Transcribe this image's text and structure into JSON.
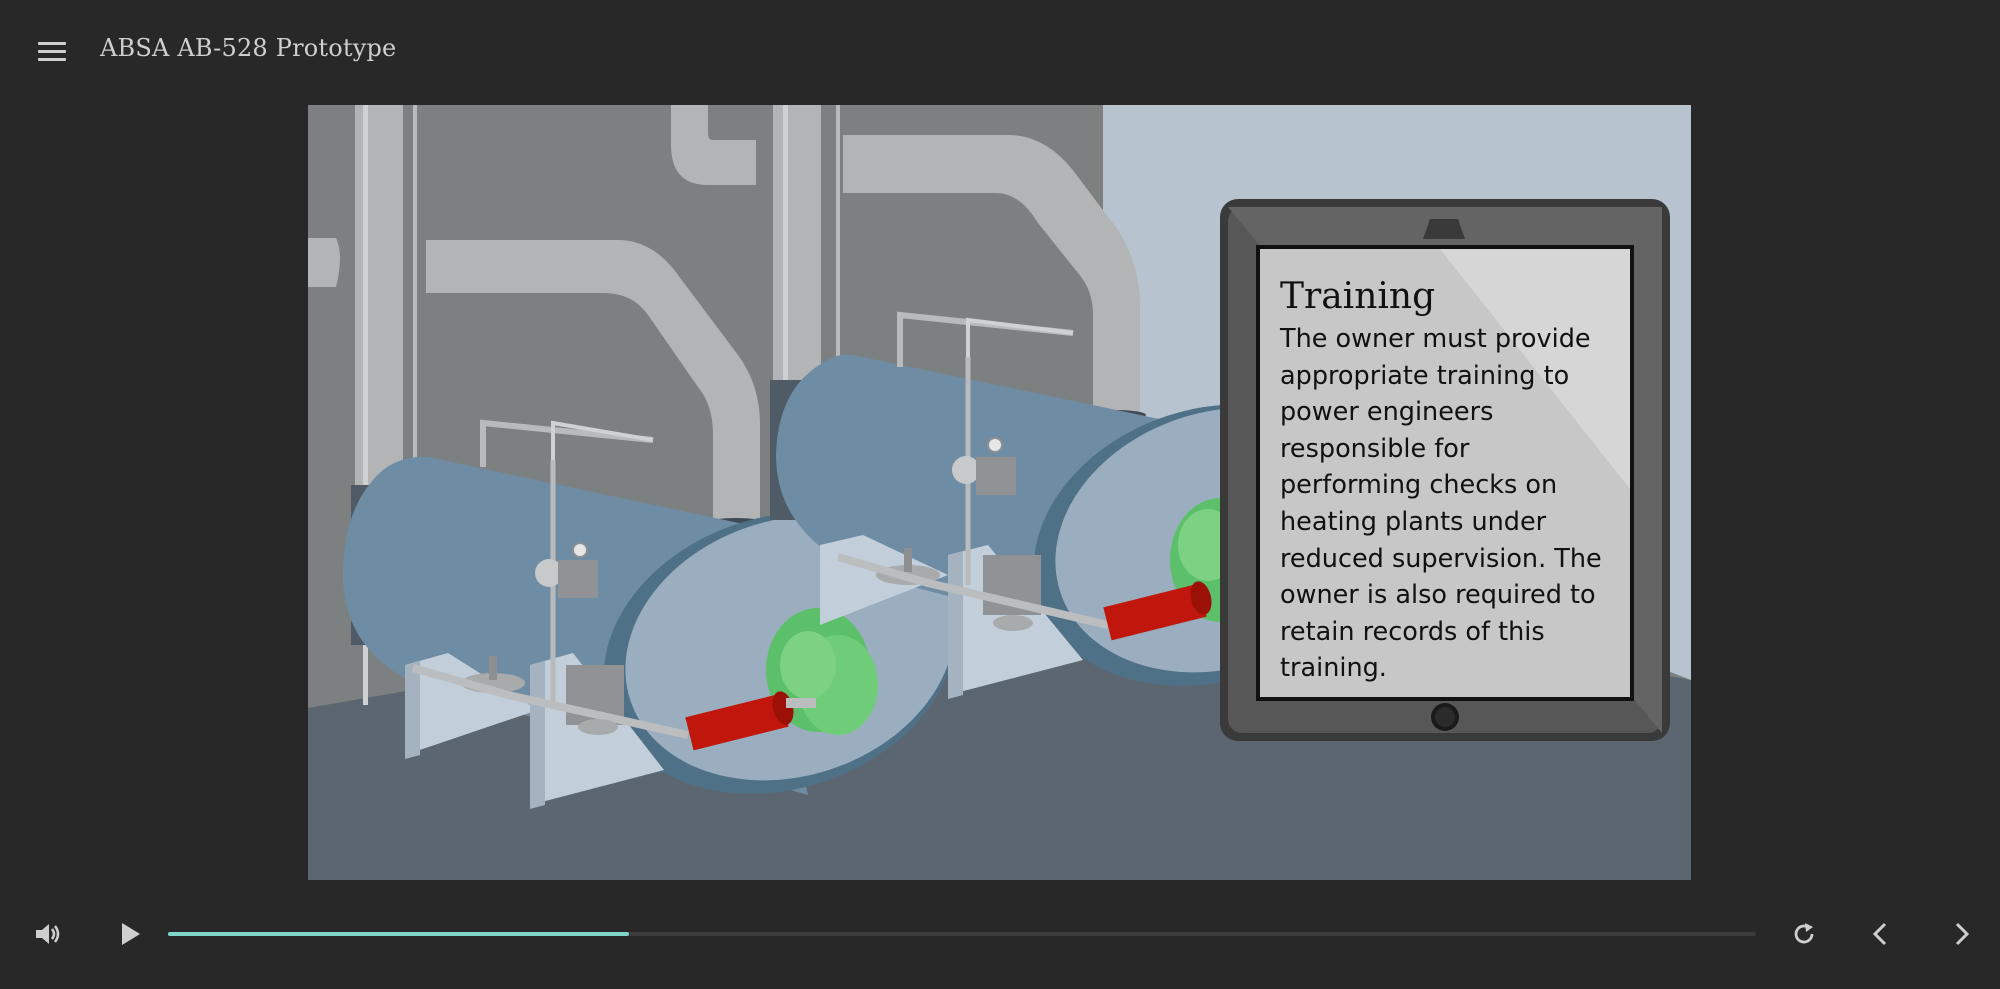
{
  "app": {
    "title": "ABSA AB-528 Prototype"
  },
  "slide": {
    "heading": "Training",
    "body": "The owner must provide appropriate training to power engineers responsible for performing checks on heating plants under reduced supervision. The owner is also required to retain records of this training."
  },
  "player": {
    "progress": 0.29
  },
  "icons": {
    "menu": "menu-icon",
    "volume": "volume-icon",
    "play": "play-icon",
    "replay": "replay-icon",
    "previous": "chevron-left-icon",
    "next": "chevron-right-icon"
  },
  "colors": {
    "accent": "#7fd6c8",
    "background": "#282828",
    "pipe_red": "#c0160b",
    "valve_green": "#5cc06a"
  }
}
